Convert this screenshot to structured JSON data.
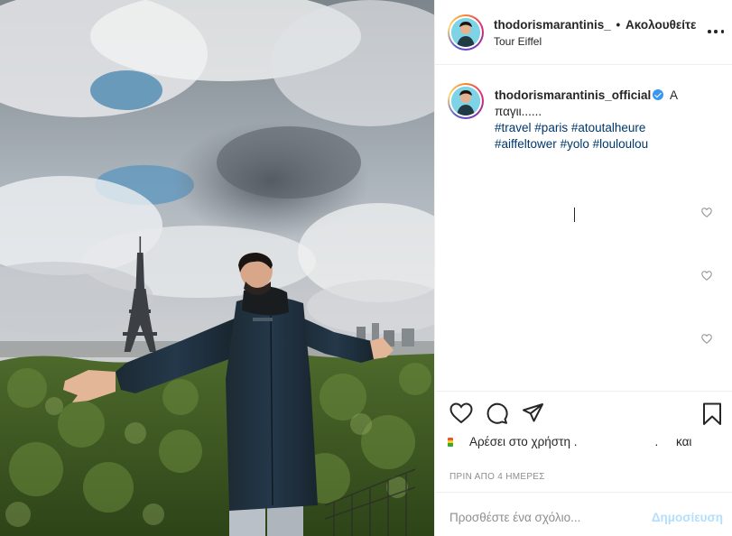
{
  "post": {
    "username": "thodorismarantinis_",
    "separator": "•",
    "follow_label": "Ακολουθείτε",
    "location": "Tour Eiffel",
    "more_icon": "more-options-icon"
  },
  "caption": {
    "username": "thodorismarantinis_official",
    "verified_icon": "verified-badge-icon",
    "text": "Α παγιι......",
    "hashtags": [
      "#travel",
      "#paris",
      "#atoutalheure",
      "#aiffeltower",
      "#yolo",
      "#louloulou"
    ]
  },
  "actions": {
    "like_icon": "heart-icon",
    "comment_icon": "comment-icon",
    "share_icon": "share-icon",
    "save_icon": "bookmark-icon"
  },
  "likes": {
    "prefix": "Αρέσει στο χρήστη",
    "dot": ".",
    "dot2": ".",
    "suffix": "και"
  },
  "timestamp": "ΠΡΙΝ ΑΠΟ 4 ΗΜΕΡΕΣ",
  "comment_box": {
    "placeholder": "Προσθέστε ένα σχόλιο...",
    "post_label": "Δημοσίευση"
  },
  "colors": {
    "link": "#00376b",
    "verified": "#3897f0",
    "post_disabled": "#b2dffc"
  }
}
